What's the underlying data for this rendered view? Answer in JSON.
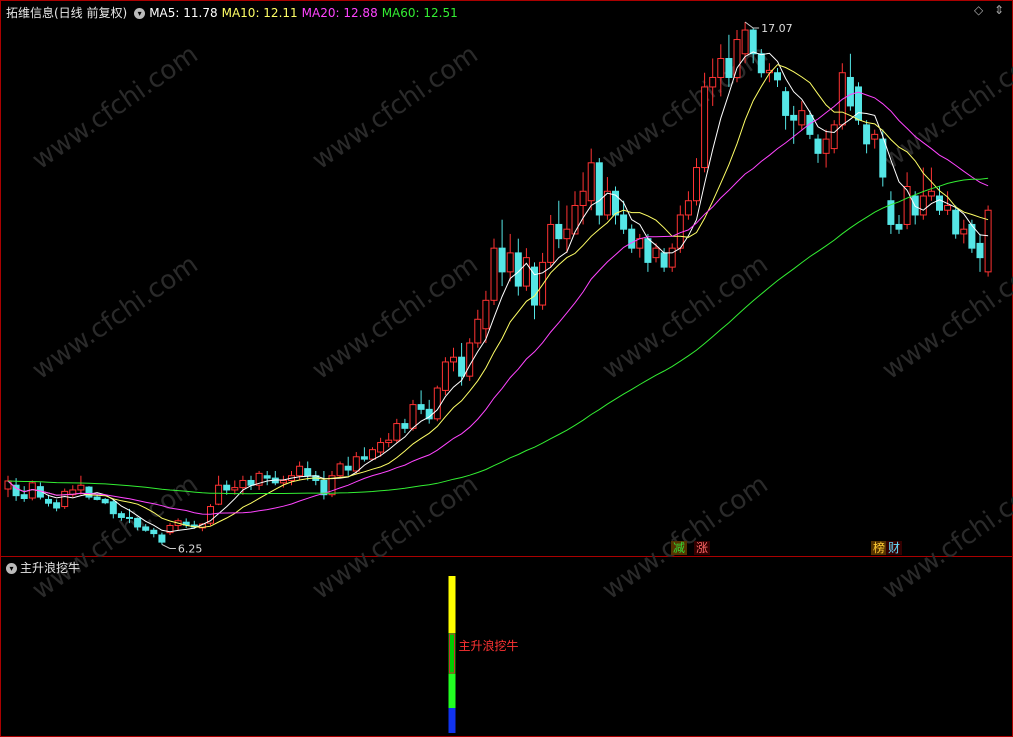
{
  "header": {
    "stock_title": "拓维信息(日线 前复权)",
    "dropdown_icon": "chevron-down-icon",
    "ma": [
      {
        "label": "MA5: 11.78",
        "color": "#ffffff"
      },
      {
        "label": "MA10: 12.11",
        "color": "#ffff66"
      },
      {
        "label": "MA20: 12.88",
        "color": "#ff44ff"
      },
      {
        "label": "MA60: 12.51",
        "color": "#33ee33"
      }
    ],
    "corner_icons": [
      "diamond-icon",
      "arrows-icon"
    ]
  },
  "annotations": {
    "high": "17.07",
    "low": "6.25"
  },
  "watermark": "www.cfchi.com",
  "signals": [
    {
      "text": "减",
      "color": "#33dd33",
      "bg": "#553300"
    },
    {
      "text": "涨",
      "color": "#ff6666",
      "bg": "#330000"
    },
    {
      "text": "榜",
      "color": "#ffcc33",
      "bg": "#553300"
    },
    {
      "text": "财",
      "color": "#66ddff",
      "bg": "#330000"
    }
  ],
  "sub_panel": {
    "title": "主升浪挖牛",
    "signal_label": "主升浪挖牛"
  },
  "colors": {
    "up": "#ff3333",
    "down": "#55e6e6",
    "border": "#aa0000"
  },
  "candles": [
    [
      7.22,
      7.5,
      7.05,
      7.39
    ],
    [
      7.3,
      7.45,
      6.97,
      7.08
    ],
    [
      7.1,
      7.28,
      6.95,
      7.02
    ],
    [
      7.03,
      7.4,
      6.98,
      7.35
    ],
    [
      7.27,
      7.36,
      7.0,
      7.05
    ],
    [
      7.0,
      7.1,
      6.85,
      6.92
    ],
    [
      6.93,
      7.0,
      6.75,
      6.82
    ],
    [
      6.85,
      7.23,
      6.8,
      7.17
    ],
    [
      7.1,
      7.3,
      7.05,
      7.2
    ],
    [
      7.2,
      7.5,
      7.1,
      7.3
    ],
    [
      7.26,
      7.28,
      7.0,
      7.05
    ],
    [
      7.05,
      7.12,
      6.98,
      7.0
    ],
    [
      7.0,
      7.03,
      6.9,
      6.93
    ],
    [
      6.95,
      7.0,
      6.6,
      6.7
    ],
    [
      6.7,
      6.75,
      6.55,
      6.62
    ],
    [
      6.62,
      6.8,
      6.5,
      6.6
    ],
    [
      6.6,
      6.62,
      6.35,
      6.42
    ],
    [
      6.42,
      6.48,
      6.32,
      6.35
    ],
    [
      6.35,
      6.4,
      6.2,
      6.28
    ],
    [
      6.25,
      6.3,
      6.05,
      6.1
    ],
    [
      6.3,
      6.5,
      6.25,
      6.45
    ],
    [
      6.45,
      6.6,
      6.35,
      6.55
    ],
    [
      6.52,
      6.6,
      6.4,
      6.46
    ],
    [
      6.46,
      6.55,
      6.38,
      6.42
    ],
    [
      6.4,
      6.5,
      6.33,
      6.48
    ],
    [
      6.5,
      6.9,
      6.45,
      6.85
    ],
    [
      6.9,
      7.5,
      6.88,
      7.3
    ],
    [
      7.3,
      7.4,
      7.1,
      7.2
    ],
    [
      7.2,
      7.4,
      7.1,
      7.25
    ],
    [
      7.25,
      7.5,
      7.1,
      7.4
    ],
    [
      7.4,
      7.5,
      7.2,
      7.3
    ],
    [
      7.3,
      7.6,
      7.2,
      7.55
    ],
    [
      7.5,
      7.6,
      7.3,
      7.45
    ],
    [
      7.45,
      7.6,
      7.3,
      7.35
    ],
    [
      7.35,
      7.5,
      7.25,
      7.4
    ],
    [
      7.4,
      7.6,
      7.3,
      7.5
    ],
    [
      7.5,
      7.8,
      7.4,
      7.7
    ],
    [
      7.65,
      7.8,
      7.4,
      7.5
    ],
    [
      7.5,
      7.6,
      7.3,
      7.4
    ],
    [
      7.4,
      7.6,
      7.0,
      7.1
    ],
    [
      7.1,
      7.6,
      7.05,
      7.5
    ],
    [
      7.5,
      7.8,
      7.45,
      7.75
    ],
    [
      7.7,
      7.9,
      7.5,
      7.62
    ],
    [
      7.6,
      8.0,
      7.55,
      7.9
    ],
    [
      7.9,
      8.1,
      7.8,
      7.85
    ],
    [
      7.85,
      8.1,
      7.82,
      8.05
    ],
    [
      8.0,
      8.3,
      7.9,
      8.2
    ],
    [
      8.2,
      8.4,
      8.1,
      8.25
    ],
    [
      8.25,
      8.7,
      8.2,
      8.6
    ],
    [
      8.6,
      8.7,
      8.4,
      8.5
    ],
    [
      8.5,
      9.1,
      8.45,
      9.0
    ],
    [
      9.0,
      9.3,
      8.8,
      8.9
    ],
    [
      8.9,
      9.1,
      8.6,
      8.7
    ],
    [
      8.7,
      9.4,
      8.65,
      9.35
    ],
    [
      9.3,
      10.0,
      9.2,
      9.9
    ],
    [
      9.9,
      10.2,
      9.7,
      10.0
    ],
    [
      10.0,
      10.3,
      9.4,
      9.6
    ],
    [
      9.6,
      10.4,
      9.5,
      10.3
    ],
    [
      10.3,
      11.0,
      10.2,
      10.8
    ],
    [
      10.6,
      11.4,
      10.3,
      11.2
    ],
    [
      11.2,
      12.5,
      11.1,
      12.3
    ],
    [
      12.3,
      12.9,
      11.5,
      11.8
    ],
    [
      11.8,
      12.6,
      11.6,
      12.2
    ],
    [
      12.2,
      12.5,
      11.3,
      11.5
    ],
    [
      11.5,
      12.3,
      11.4,
      12.1
    ],
    [
      11.9,
      12.0,
      10.8,
      11.1
    ],
    [
      11.1,
      12.2,
      11.0,
      12.0
    ],
    [
      12.0,
      13.0,
      11.9,
      12.8
    ],
    [
      12.8,
      13.3,
      12.3,
      12.5
    ],
    [
      12.5,
      13.2,
      12.2,
      12.7
    ],
    [
      12.6,
      13.5,
      12.6,
      13.2
    ],
    [
      13.2,
      13.9,
      12.8,
      13.5
    ],
    [
      13.3,
      14.4,
      13.1,
      14.1
    ],
    [
      14.1,
      14.2,
      12.8,
      13.0
    ],
    [
      13.0,
      13.8,
      12.9,
      13.5
    ],
    [
      13.5,
      13.6,
      12.8,
      13.0
    ],
    [
      13.0,
      13.3,
      12.6,
      12.7
    ],
    [
      12.7,
      12.8,
      12.2,
      12.3
    ],
    [
      12.3,
      12.6,
      12.1,
      12.5
    ],
    [
      12.5,
      12.6,
      11.8,
      12.0
    ],
    [
      12.1,
      12.4,
      12.0,
      12.3
    ],
    [
      12.2,
      12.3,
      11.8,
      11.9
    ],
    [
      11.9,
      12.4,
      11.8,
      12.3
    ],
    [
      12.3,
      13.2,
      12.2,
      13.0
    ],
    [
      13.0,
      13.5,
      12.9,
      13.3
    ],
    [
      13.3,
      14.2,
      13.2,
      14.0
    ],
    [
      14.0,
      16.0,
      13.9,
      15.7
    ],
    [
      15.7,
      16.3,
      15.3,
      15.9
    ],
    [
      15.9,
      16.6,
      15.5,
      16.3
    ],
    [
      16.3,
      16.8,
      15.7,
      15.9
    ],
    [
      15.9,
      16.9,
      15.8,
      16.7
    ],
    [
      16.4,
      17.07,
      16.2,
      16.9
    ],
    [
      16.9,
      16.95,
      16.2,
      16.4
    ],
    [
      16.4,
      16.5,
      15.9,
      16.0
    ],
    [
      16.0,
      16.2,
      15.8,
      16.05
    ],
    [
      16.0,
      16.1,
      15.7,
      15.85
    ],
    [
      15.6,
      15.7,
      14.8,
      15.1
    ],
    [
      15.1,
      15.3,
      14.5,
      15.0
    ],
    [
      14.9,
      15.4,
      14.8,
      15.2
    ],
    [
      15.1,
      15.2,
      14.6,
      14.7
    ],
    [
      14.6,
      14.7,
      14.1,
      14.3
    ],
    [
      14.3,
      14.8,
      14.0,
      14.6
    ],
    [
      14.4,
      15.0,
      14.3,
      14.9
    ],
    [
      14.9,
      16.2,
      14.8,
      16.0
    ],
    [
      15.9,
      16.4,
      15.2,
      15.3
    ],
    [
      15.7,
      15.8,
      14.9,
      15.0
    ],
    [
      14.9,
      15.0,
      14.3,
      14.5
    ],
    [
      14.6,
      14.8,
      14.4,
      14.7
    ],
    [
      14.6,
      14.8,
      13.6,
      13.8
    ],
    [
      13.3,
      13.5,
      12.6,
      12.8
    ],
    [
      12.8,
      13.0,
      12.6,
      12.7
    ],
    [
      12.8,
      13.9,
      12.7,
      13.6
    ],
    [
      13.4,
      13.5,
      12.8,
      13.0
    ],
    [
      13.0,
      14.0,
      12.9,
      13.4
    ],
    [
      13.4,
      14.0,
      13.3,
      13.5
    ],
    [
      13.4,
      13.6,
      13.0,
      13.1
    ],
    [
      13.1,
      13.5,
      13.0,
      13.2
    ],
    [
      13.1,
      13.2,
      12.5,
      12.6
    ],
    [
      12.6,
      12.9,
      12.4,
      12.7
    ],
    [
      12.8,
      12.9,
      12.2,
      12.3
    ],
    [
      12.4,
      12.6,
      11.8,
      12.1
    ],
    [
      11.8,
      13.2,
      11.7,
      13.1
    ]
  ]
}
